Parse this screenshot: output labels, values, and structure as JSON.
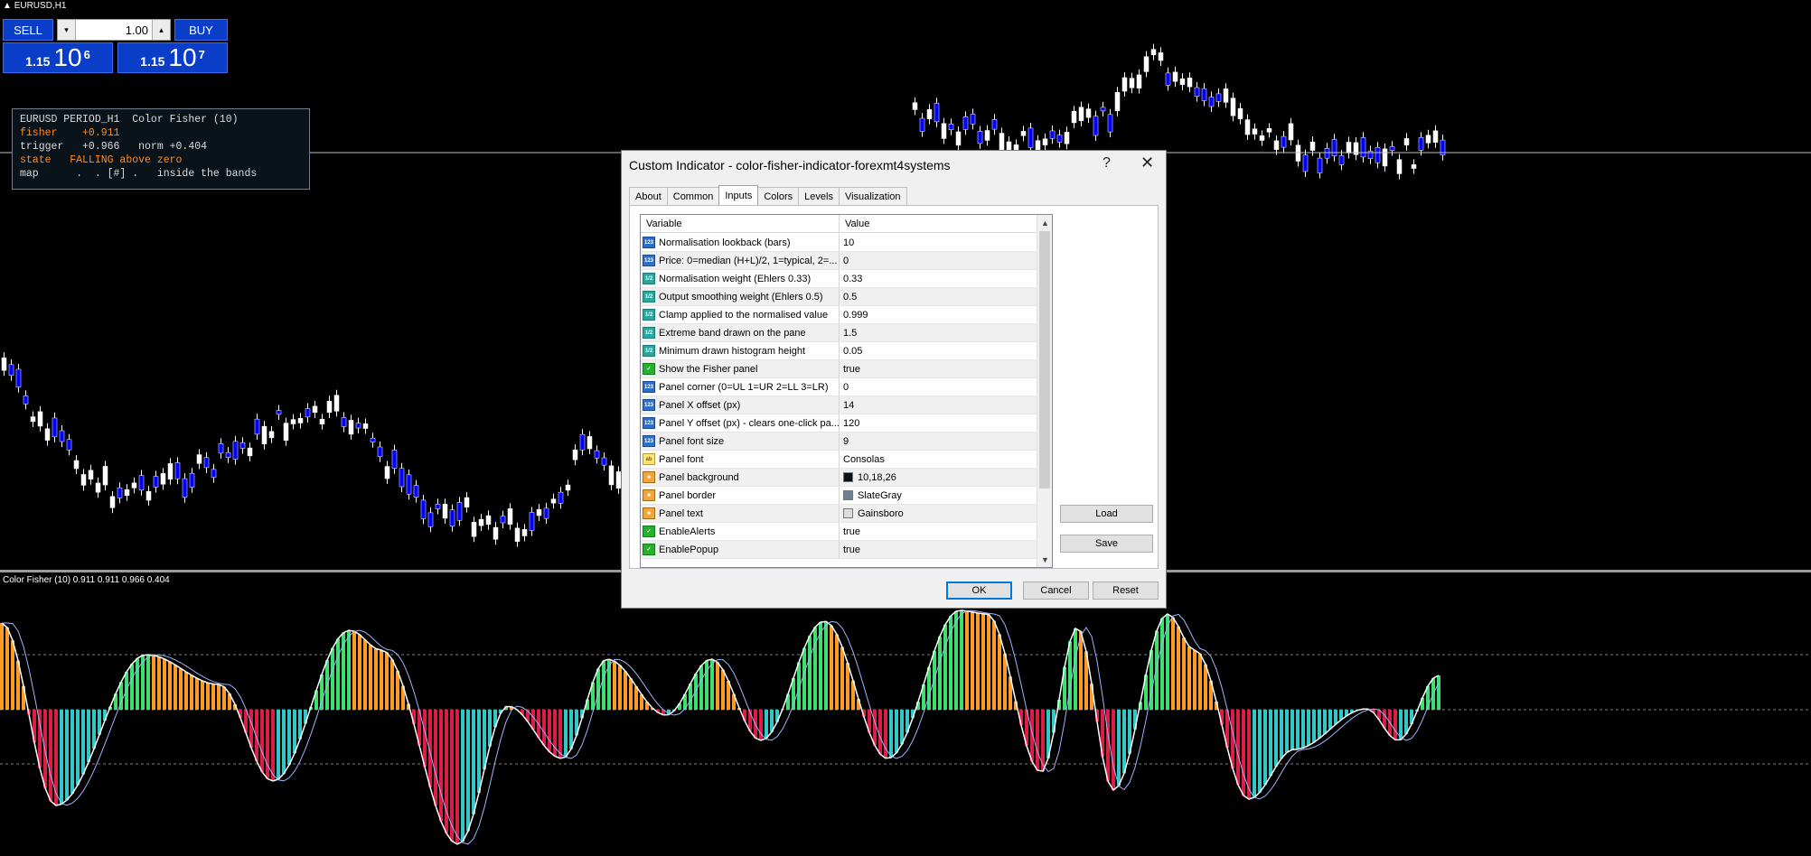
{
  "chart": {
    "symbol_title": "EURUSD,H1",
    "subwindow_label": "Color Fisher (10) 0.911 0.911 0.966 0.404",
    "colors": {
      "bull": "#0000ff",
      "bear": "#ffffff",
      "neutral": "#00ff00",
      "hist_up": "#3ce06e",
      "hist_down": "#dc1e46",
      "hist_fall": "#ff9b23",
      "hist_rise": "#32c8c8",
      "trigger": "#a0b4ff",
      "levels": "#808080"
    }
  },
  "one_click": {
    "sell_label": "SELL",
    "buy_label": "BUY",
    "lot_value": "1.00",
    "down_arrow": "▾",
    "up_arrow": "▴",
    "sell_price_small": "1.15",
    "sell_price_big": "10",
    "sell_price_sup": "6",
    "buy_price_small": "1.15",
    "buy_price_big": "10",
    "buy_price_sup": "7"
  },
  "info_panel": {
    "line1": "EURUSD PERIOD_H1  Color Fisher (10)",
    "line2": "fisher    +0.911",
    "line3": "trigger   +0.966   norm +0.404",
    "line4": "state   FALLING above zero",
    "line5": "map      .  . [#] .   inside the bands"
  },
  "dialog": {
    "title": "Custom Indicator - color-fisher-indicator-forexmt4systems",
    "help_label": "?",
    "close_label": "✕",
    "tabs": [
      "About",
      "Common",
      "Inputs",
      "Colors",
      "Levels",
      "Visualization"
    ],
    "active_tab": "Inputs",
    "grid": {
      "col_variable": "Variable",
      "col_value": "Value",
      "rows": [
        {
          "type": "int",
          "icon": "123",
          "name": "Normalisation lookback (bars)",
          "value": "10"
        },
        {
          "type": "int",
          "icon": "123",
          "name": "Price: 0=median (H+L)/2, 1=typical, 2=...",
          "value": "0"
        },
        {
          "type": "dbl",
          "icon": "1/2",
          "name": "Normalisation weight (Ehlers 0.33)",
          "value": "0.33"
        },
        {
          "type": "dbl",
          "icon": "1/2",
          "name": "Output smoothing weight (Ehlers 0.5)",
          "value": "0.5"
        },
        {
          "type": "dbl",
          "icon": "1/2",
          "name": "Clamp applied to the normalised value",
          "value": "0.999"
        },
        {
          "type": "dbl",
          "icon": "1/2",
          "name": "Extreme band drawn on the pane",
          "value": "1.5"
        },
        {
          "type": "dbl",
          "icon": "1/2",
          "name": "Minimum drawn histogram height",
          "value": "0.05"
        },
        {
          "type": "bool",
          "icon": "✓",
          "name": "Show the Fisher panel",
          "value": "true"
        },
        {
          "type": "int",
          "icon": "123",
          "name": "Panel corner (0=UL 1=UR 2=LL 3=LR)",
          "value": "0"
        },
        {
          "type": "int",
          "icon": "123",
          "name": "Panel X offset (px)",
          "value": "14"
        },
        {
          "type": "int",
          "icon": "123",
          "name": "Panel Y offset (px) - clears one-click pa...",
          "value": "120"
        },
        {
          "type": "int",
          "icon": "123",
          "name": "Panel font size",
          "value": "9"
        },
        {
          "type": "str",
          "icon": "ab",
          "name": "Panel font",
          "value": "Consolas"
        },
        {
          "type": "clr",
          "icon": "■",
          "name": "Panel background",
          "value": "10,18,26",
          "swatch": "#0a121a"
        },
        {
          "type": "clr",
          "icon": "■",
          "name": "Panel border",
          "value": "SlateGray",
          "swatch": "#708090"
        },
        {
          "type": "clr",
          "icon": "■",
          "name": "Panel text",
          "value": "Gainsboro",
          "swatch": "#dcdcdc"
        },
        {
          "type": "bool",
          "icon": "✓",
          "name": "EnableAlerts",
          "value": "true"
        },
        {
          "type": "bool",
          "icon": "✓",
          "name": "EnablePopup",
          "value": "true"
        }
      ]
    },
    "scroll_up": "▲",
    "scroll_down": "▼",
    "load_label": "Load",
    "save_label": "Save",
    "ok_label": "OK",
    "cancel_label": "Cancel",
    "reset_label": "Reset"
  }
}
